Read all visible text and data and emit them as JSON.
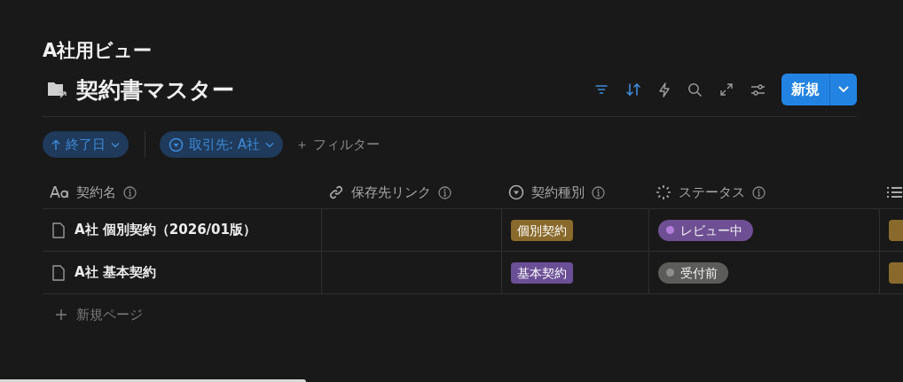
{
  "view_title": "A社用ビュー",
  "page_title": "契約書マスター",
  "toolbar": {
    "icons": [
      {
        "kind": "filter",
        "active": true
      },
      {
        "kind": "sort",
        "active": true
      },
      {
        "kind": "automation",
        "active": false
      },
      {
        "kind": "search",
        "active": false
      },
      {
        "kind": "expand",
        "active": false
      },
      {
        "kind": "settings",
        "active": false
      }
    ],
    "new_button": "新規"
  },
  "filters": [
    {
      "kind": "sort",
      "label": "終了日"
    },
    {
      "kind": "select",
      "label": "取引先: A社"
    }
  ],
  "add_filter": "＋ フィルター",
  "table": {
    "columns": [
      {
        "kind": "title",
        "label": "契約名"
      },
      {
        "kind": "link",
        "label": "保存先リンク"
      },
      {
        "kind": "select",
        "label": "契約種別"
      },
      {
        "kind": "status",
        "label": "ステータス"
      },
      {
        "kind": "list"
      }
    ],
    "rows": [
      {
        "name": "A社 個別契約（2026/01版）",
        "type": {
          "label": "個別契約",
          "color": "#8a6a2c"
        },
        "status": {
          "label": "レビュー中",
          "color": "#6e4f93",
          "dot": {
            "color": "#b07fd8"
          }
        },
        "column_5": {
          "color": "#8a6a2c"
        }
      },
      {
        "name": "A社 基本契約",
        "type": {
          "label": "基本契約",
          "color": "#6b4f96"
        },
        "status": {
          "label": "受付前",
          "color": "#5c5c5a",
          "dot": {
            "color": "#8e8e8c"
          }
        },
        "column_5": {
          "color": "#8a6a2c"
        }
      }
    ],
    "new_page": "新規ページ"
  }
}
